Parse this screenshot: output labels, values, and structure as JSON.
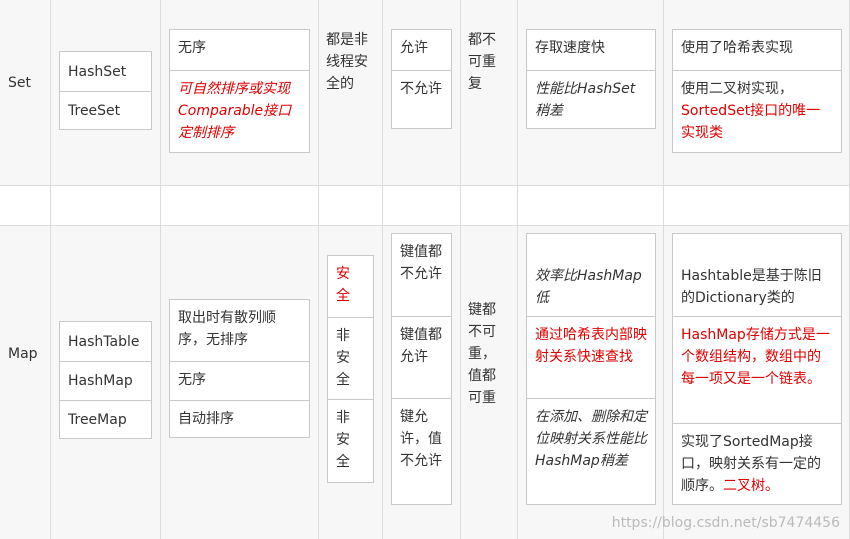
{
  "set": {
    "name": "Set",
    "impls": [
      "HashSet",
      "TreeSet"
    ],
    "order": {
      "a": "无序",
      "b": "可自然排序或实现Comparable接口定制排序"
    },
    "thread_safety": "都是非线程安全的",
    "null_values": {
      "a": "允许",
      "b": "不允许"
    },
    "duplicates": "都不可重复",
    "performance": {
      "a": "存取速度快",
      "b": "性能比HashSet稍差"
    },
    "implementation": {
      "a": "使用了哈希表实现",
      "b1": "使用二叉树实现，",
      "b2": "SortedSet接口的唯一实现类"
    }
  },
  "map": {
    "name": "Map",
    "impls": [
      "HashTable",
      "HashMap",
      "TreeMap"
    ],
    "order": [
      "取出时有散列顺序，无排序",
      "无序",
      "自动排序"
    ],
    "thread_safety": [
      "安全",
      "非安全",
      "非安全"
    ],
    "null_values": [
      "键值都不允许",
      "键值都允许",
      "键允许，值不允许"
    ],
    "duplicates": "键都不可重，值都可重",
    "performance": [
      "效率比HashMap低",
      "通过哈希表内部映射关系快速查找",
      "在添加、删除和定位映射关系性能比HashMap稍差"
    ],
    "implementation": {
      "a": "Hashtable是基于陈旧的Dictionary类的",
      "b": "HashMap存储方式是一个数组结构，数组中的每一项又是一个链表。",
      "c1": "实现了SortedMap接口，映射关系有一定的顺序。",
      "c2": "二叉树。"
    }
  },
  "watermark": "https://blog.csdn.net/sb7474456",
  "colors": {
    "accent_red": "#e00000",
    "row_bg": "#f7f7f7",
    "border": "#c9c9c9"
  }
}
